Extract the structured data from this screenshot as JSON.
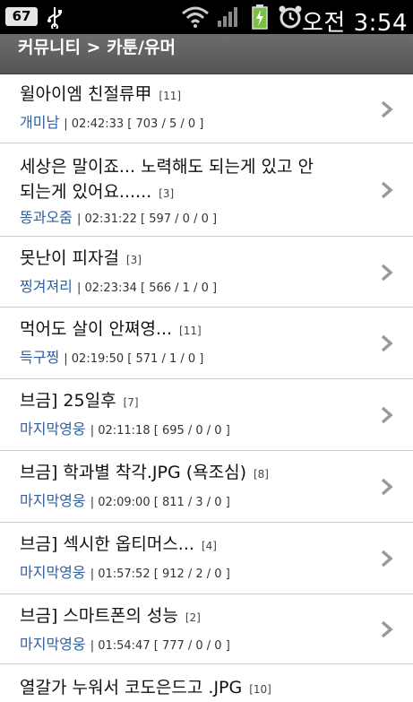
{
  "status_bar": {
    "badge": "67",
    "time": "오전 3:54",
    "icons": [
      "usb-icon",
      "wifi-icon",
      "signal-icon",
      "battery-icon",
      "alarm-icon"
    ]
  },
  "title_bar": {
    "breadcrumb": "커뮤니티 > 카툰/유머"
  },
  "posts": [
    {
      "title": "윌아이엠 친절류甲",
      "count": "[11]",
      "author": "개미남",
      "stats": "| 02:42:33 [ 703 / 5 / 0 ]"
    },
    {
      "title_lines": [
        "세상은 말이죠... 노력해도 되는게 있고 안",
        "되는게 있어요......"
      ],
      "count": "[3]",
      "author": "똥과오줌",
      "stats": "| 02:31:22 [ 597 / 0 / 0 ]"
    },
    {
      "title": "못난이 피자걸",
      "count": "[3]",
      "author": "찡겨져리",
      "stats": "| 02:23:34 [ 566 / 1 / 0 ]"
    },
    {
      "title": "먹어도 살이 안쪄영...",
      "count": "[11]",
      "author": "득구찡",
      "stats": "| 02:19:50 [ 571 / 1 / 0 ]"
    },
    {
      "title": "브금] 25일후",
      "count": "[7]",
      "author": "마지막영웅",
      "stats": "| 02:11:18 [ 695 / 0 / 0 ]"
    },
    {
      "title": "브금] 학과별 착각.JPG (욕조심)",
      "count": "[8]",
      "author": "마지막영웅",
      "stats": "| 02:09:00 [ 811 / 3 / 0 ]"
    },
    {
      "title": "브금] 섹시한 옵티머스...",
      "count": "[4]",
      "author": "마지막영웅",
      "stats": "| 01:57:52 [ 912 / 2 / 0 ]"
    },
    {
      "title": "브금] 스마트폰의 성능",
      "count": "[2]",
      "author": "마지막영웅",
      "stats": "| 01:54:47 [ 777 / 0 / 0 ]"
    },
    {
      "title": "열갈가 누워서 코도은드고 .JPG",
      "count": "[10]",
      "author": "",
      "stats": ""
    }
  ]
}
